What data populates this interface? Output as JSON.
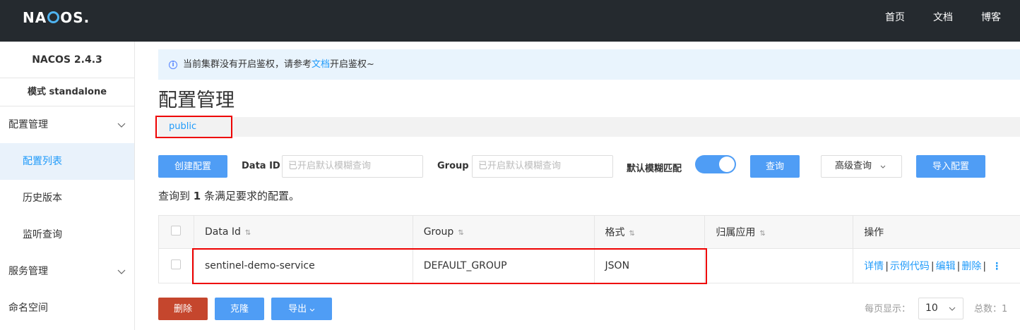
{
  "header": {
    "logo": "NACOS.",
    "nav": [
      "首页",
      "文档",
      "博客"
    ]
  },
  "sidebar": {
    "version": "NACOS 2.4.3",
    "mode": "模式 standalone",
    "items": [
      {
        "label": "配置管理"
      },
      {
        "label": "配置列表"
      },
      {
        "label": "历史版本"
      },
      {
        "label": "监听查询"
      },
      {
        "label": "服务管理"
      },
      {
        "label": "命名空间"
      }
    ]
  },
  "notice": {
    "prefix": "当前集群没有开启鉴权，请参考",
    "link": "文档",
    "suffix": "开启鉴权~"
  },
  "page": {
    "title": "配置管理",
    "namespace": "public"
  },
  "toolbar": {
    "create_label": "创建配置",
    "dataid_label": "Data ID",
    "dataid_placeholder": "已开启默认模糊查询",
    "group_label": "Group",
    "group_placeholder": "已开启默认模糊查询",
    "fuzzy_label": "默认模糊匹配",
    "fuzzy_on": true,
    "query_label": "查询",
    "advanced_label": "高级查询",
    "import_label": "导入配置"
  },
  "result": {
    "prefix": "查询到",
    "count": "1",
    "suffix": "条满足要求的配置。"
  },
  "table": {
    "headers": [
      "Data Id",
      "Group",
      "格式",
      "归属应用",
      "操作"
    ],
    "rows": [
      {
        "data_id": "sentinel-demo-service",
        "group": "DEFAULT_GROUP",
        "format": "JSON",
        "app": "",
        "ops": [
          "详情",
          "示例代码",
          "编辑",
          "删除"
        ]
      }
    ]
  },
  "footer": {
    "delete_label": "删除",
    "clone_label": "克隆",
    "export_label": "导出",
    "page_size_label": "每页显示：",
    "page_size": "10",
    "total": "总数：1"
  },
  "colors": {
    "primary": "#4f9df5",
    "danger": "#c5462d",
    "highlight": "#e00000",
    "topbar": "#252a2f"
  }
}
